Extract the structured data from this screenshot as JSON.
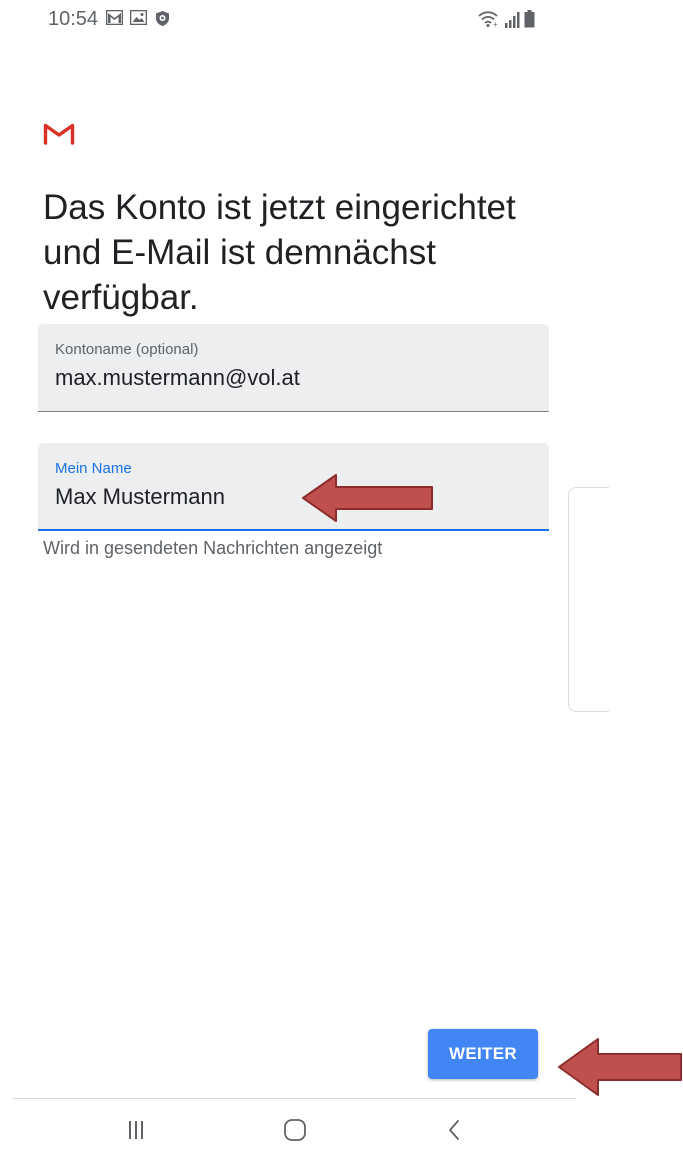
{
  "status_bar": {
    "time": "10:54",
    "notification_icons": [
      "gmail-notification-icon",
      "gallery-notification-icon",
      "security-notification-icon"
    ],
    "system_icons": [
      "wifi-icon",
      "signal-icon",
      "battery-icon"
    ]
  },
  "app": {
    "logo_icon": "gmail-logo-icon",
    "brand_color": "#d93025"
  },
  "headline": "Das Konto ist jetzt eingerichtet und E-Mail ist demnächst verfügbar.",
  "account_field": {
    "label": "Kontoname (optional)",
    "value": "max.mustermann@vol.at"
  },
  "name_field": {
    "label": "Mein Name",
    "value": "Max Mustermann",
    "helper": "Wird in gesendeten Nachrichten angezeigt",
    "accent": "#1a73e8"
  },
  "next_button": {
    "label": "WEITER",
    "color": "#4285f4"
  },
  "annotations": {
    "arrow_color": "#c0504d"
  },
  "navigation_bar": {
    "items": [
      "recent-apps-icon",
      "home-icon",
      "back-icon"
    ]
  }
}
